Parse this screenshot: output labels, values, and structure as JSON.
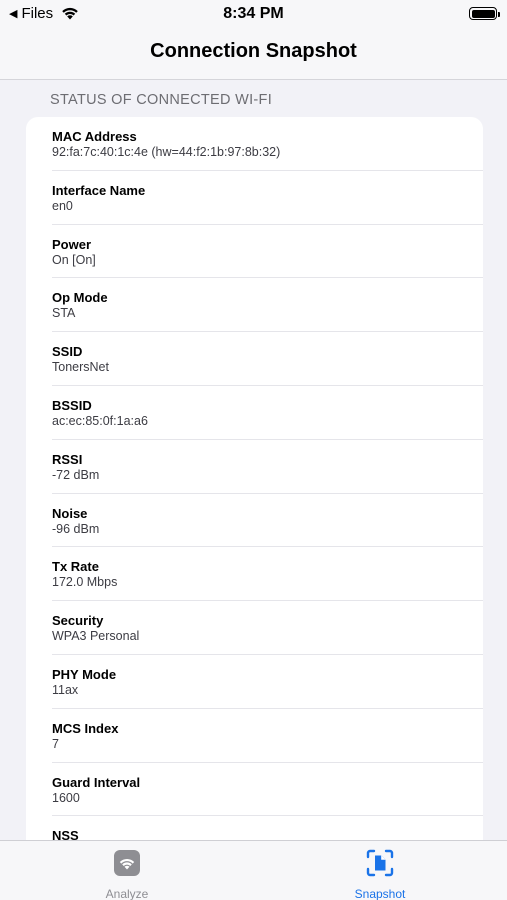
{
  "status_bar": {
    "back_label": "Files",
    "time": "8:34 PM"
  },
  "nav": {
    "title": "Connection Snapshot"
  },
  "section": {
    "header": "STATUS OF CONNECTED WI-FI"
  },
  "rows": [
    {
      "label": "MAC Address",
      "value": "92:fa:7c:40:1c:4e (hw=44:f2:1b:97:8b:32)"
    },
    {
      "label": "Interface Name",
      "value": "en0"
    },
    {
      "label": "Power",
      "value": "On [On]"
    },
    {
      "label": "Op Mode",
      "value": "STA"
    },
    {
      "label": "SSID",
      "value": "TonersNet"
    },
    {
      "label": "BSSID",
      "value": "ac:ec:85:0f:1a:a6"
    },
    {
      "label": "RSSI",
      "value": "-72 dBm"
    },
    {
      "label": "Noise",
      "value": "-96 dBm"
    },
    {
      "label": "Tx Rate",
      "value": "172.0 Mbps"
    },
    {
      "label": "Security",
      "value": "WPA3 Personal"
    },
    {
      "label": "PHY Mode",
      "value": "11ax"
    },
    {
      "label": "MCS Index",
      "value": "7"
    },
    {
      "label": "Guard Interval",
      "value": "1600"
    },
    {
      "label": "NSS",
      "value": ""
    }
  ],
  "tabs": [
    {
      "label": "Analyze",
      "icon": "wifi-icon",
      "selected": false
    },
    {
      "label": "Snapshot",
      "icon": "snapshot-icon",
      "selected": true
    }
  ],
  "colors": {
    "accent": "#1a73e8",
    "inactive": "#8e8e93",
    "background": "#f2f2f7"
  }
}
